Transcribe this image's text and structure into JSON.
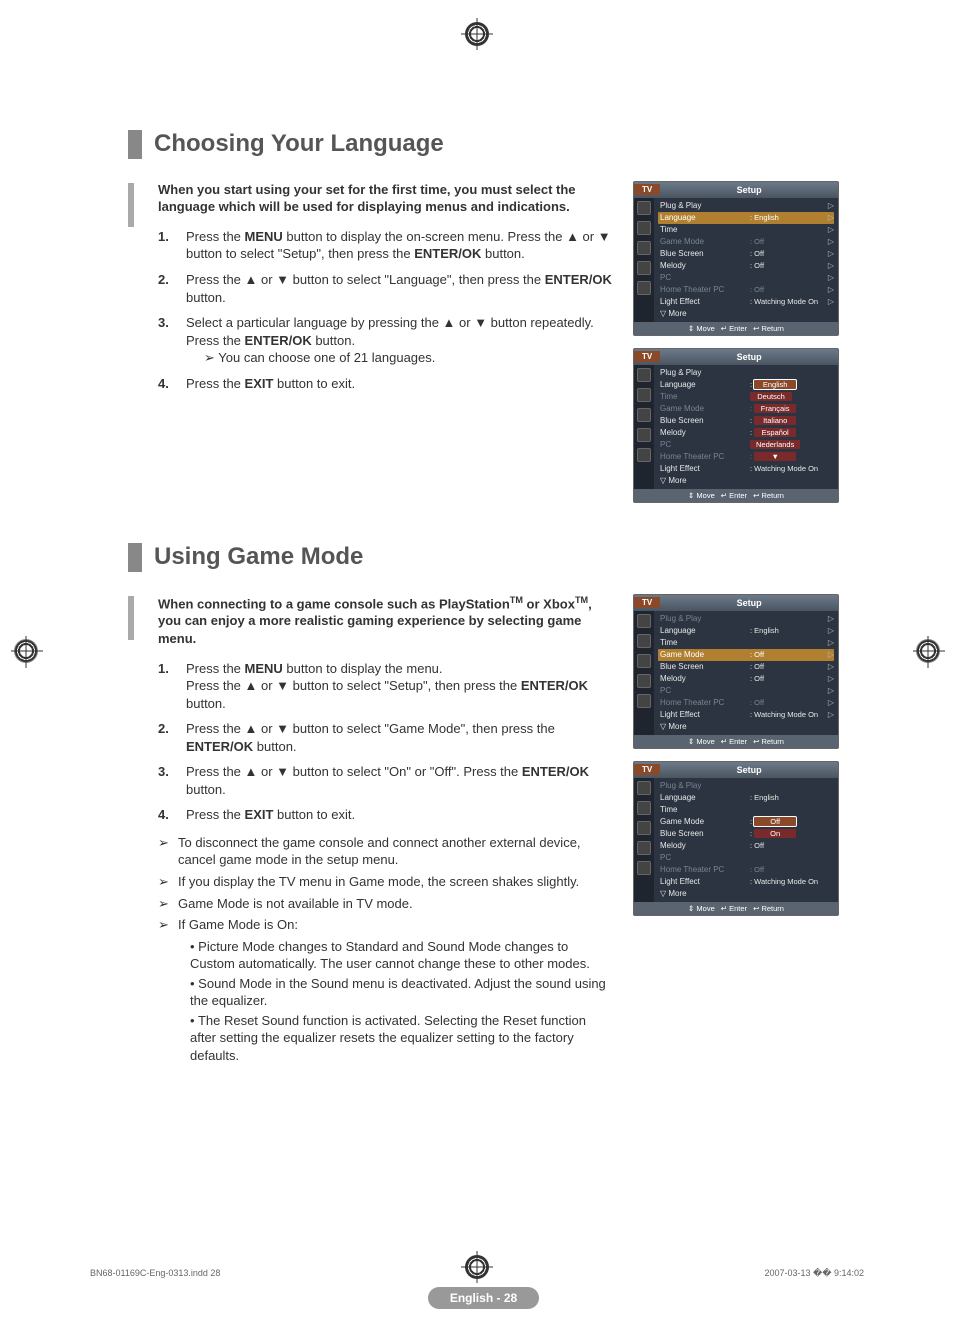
{
  "registration": {
    "present": true
  },
  "section1": {
    "title": "Choosing Your Language",
    "intro": "When you start using your set for the first time, you must select the language which will be used for displaying menus and indications.",
    "steps": [
      {
        "n": "1.",
        "html": "Press the <strong>MENU</strong> button to display the on-screen menu. Press the ▲ or ▼ button to select \"Setup\", then press the <strong>ENTER/OK</strong> button."
      },
      {
        "n": "2.",
        "html": "Press the ▲ or ▼ button to select \"Language\", then press the <strong>ENTER/OK</strong> button."
      },
      {
        "n": "3.",
        "html": "Select a particular language by pressing the ▲ or ▼ button repeatedly.<br>Press the <strong>ENTER/OK</strong> button.",
        "sub": "You can choose one of 21 languages."
      },
      {
        "n": "4.",
        "html": "Press the <strong>EXIT</strong> button to exit."
      }
    ]
  },
  "section2": {
    "title": "Using Game Mode",
    "intro_html": "When connecting to a game console such as PlayStation<sup>TM</sup> or Xbox<sup>TM</sup>, you can enjoy a more realistic gaming experience by selecting game menu.",
    "steps": [
      {
        "n": "1.",
        "html": "Press the <strong>MENU</strong> button to display the menu.<br>Press the ▲ or ▼ button to select \"Setup\", then press the <strong>ENTER/OK</strong> button."
      },
      {
        "n": "2.",
        "html": "Press the ▲ or ▼ button to select \"Game Mode\", then press the <strong>ENTER/OK</strong> button."
      },
      {
        "n": "3.",
        "html": "Press the ▲ or ▼ button to select \"On\" or \"Off\". Press the <strong>ENTER/OK</strong> button."
      },
      {
        "n": "4.",
        "html": "Press the <strong>EXIT</strong> button to exit."
      }
    ],
    "notes": [
      "To disconnect the game console and connect another external device, cancel game mode in the setup menu.",
      "If you display the TV menu in Game mode, the screen shakes slightly.",
      "Game Mode is not available in TV mode.",
      "If Game Mode is On:"
    ],
    "bullets": [
      "Picture Mode changes to Standard and Sound Mode changes to Custom automatically. The user cannot change these to other modes.",
      "Sound Mode in the Sound menu is deactivated. Adjust the sound using the equalizer.",
      "The Reset Sound function is activated. Selecting the Reset function after setting the equalizer resets the equalizer setting to the factory defaults."
    ]
  },
  "osd": {
    "tv": "TV",
    "title": "Setup",
    "foot": {
      "move": "Move",
      "enter": "Enter",
      "return": "Return"
    },
    "rows_base": [
      {
        "lbl": "Plug & Play",
        "val": "",
        "arr": "▷",
        "dim": false
      },
      {
        "lbl": "Language",
        "val": ": English",
        "arr": "▷",
        "dim": false
      },
      {
        "lbl": "Time",
        "val": "",
        "arr": "▷",
        "dim": false
      },
      {
        "lbl": "Game Mode",
        "val": ": Off",
        "arr": "▷",
        "dim": true
      },
      {
        "lbl": "Blue Screen",
        "val": ": Off",
        "arr": "▷",
        "dim": false
      },
      {
        "lbl": "Melody",
        "val": ": Off",
        "arr": "▷",
        "dim": false
      },
      {
        "lbl": "PC",
        "val": "",
        "arr": "▷",
        "dim": true
      },
      {
        "lbl": "Home Theater PC",
        "val": ": Off",
        "arr": "▷",
        "dim": true
      },
      {
        "lbl": "Light Effect",
        "val": ": Watching Mode On",
        "arr": "▷",
        "dim": false
      },
      {
        "lbl": "More",
        "val": "",
        "arr": "",
        "dim": false,
        "more": true
      }
    ],
    "panelA_highlight": "Language",
    "panelB_lang_options": [
      "English",
      "Deutsch",
      "Français",
      "Italiano",
      "Español",
      "Nederlands",
      "▼"
    ],
    "panelB": [
      {
        "lbl": "Plug & Play",
        "val": "",
        "dim": false
      },
      {
        "lbl": "Language",
        "val": ":",
        "dim": false
      },
      {
        "lbl": "Time",
        "val": "",
        "dim": true
      },
      {
        "lbl": "Game Mode",
        "val": ":",
        "dim": true
      },
      {
        "lbl": "Blue Screen",
        "val": ":",
        "dim": false
      },
      {
        "lbl": "Melody",
        "val": ":",
        "dim": false
      },
      {
        "lbl": "PC",
        "val": "",
        "dim": true
      },
      {
        "lbl": "Home Theater PC",
        "val": ":",
        "dim": true
      },
      {
        "lbl": "Light Effect",
        "val": ": Watching Mode On",
        "dim": false
      },
      {
        "lbl": "More",
        "val": "",
        "dim": false,
        "more": true
      }
    ],
    "panelC_highlight": "Game Mode",
    "panelC": [
      {
        "lbl": "Plug & Play",
        "val": "",
        "arr": "▷",
        "dim": true
      },
      {
        "lbl": "Language",
        "val": ": English",
        "arr": "▷",
        "dim": false
      },
      {
        "lbl": "Time",
        "val": "",
        "arr": "▷",
        "dim": false
      },
      {
        "lbl": "Game Mode",
        "val": ": Off",
        "arr": "▷",
        "dim": false,
        "hl": true
      },
      {
        "lbl": "Blue Screen",
        "val": ": Off",
        "arr": "▷",
        "dim": false
      },
      {
        "lbl": "Melody",
        "val": ": Off",
        "arr": "▷",
        "dim": false
      },
      {
        "lbl": "PC",
        "val": "",
        "arr": "▷",
        "dim": true
      },
      {
        "lbl": "Home Theater PC",
        "val": ": Off",
        "arr": "▷",
        "dim": true
      },
      {
        "lbl": "Light Effect",
        "val": ": Watching Mode On",
        "arr": "▷",
        "dim": false
      },
      {
        "lbl": "More",
        "val": "",
        "arr": "",
        "dim": false,
        "more": true
      }
    ],
    "panelD_options": [
      "Off",
      "On"
    ],
    "panelD": [
      {
        "lbl": "Plug & Play",
        "val": "",
        "dim": true
      },
      {
        "lbl": "Language",
        "val": ": English",
        "dim": false
      },
      {
        "lbl": "Time",
        "val": "",
        "dim": false
      },
      {
        "lbl": "Game Mode",
        "val": ":",
        "dim": false
      },
      {
        "lbl": "Blue Screen",
        "val": ":",
        "dim": false
      },
      {
        "lbl": "Melody",
        "val": ": Off",
        "dim": false
      },
      {
        "lbl": "PC",
        "val": "",
        "dim": true
      },
      {
        "lbl": "Home Theater PC",
        "val": ": Off",
        "dim": true
      },
      {
        "lbl": "Light Effect",
        "val": ": Watching Mode On",
        "dim": false
      },
      {
        "lbl": "More",
        "val": "",
        "dim": false,
        "more": true
      }
    ]
  },
  "footer": {
    "page": "English - 28",
    "indd": "BN68-01169C-Eng-0313.indd   28",
    "date": "2007-03-13   �� 9:14:02"
  }
}
